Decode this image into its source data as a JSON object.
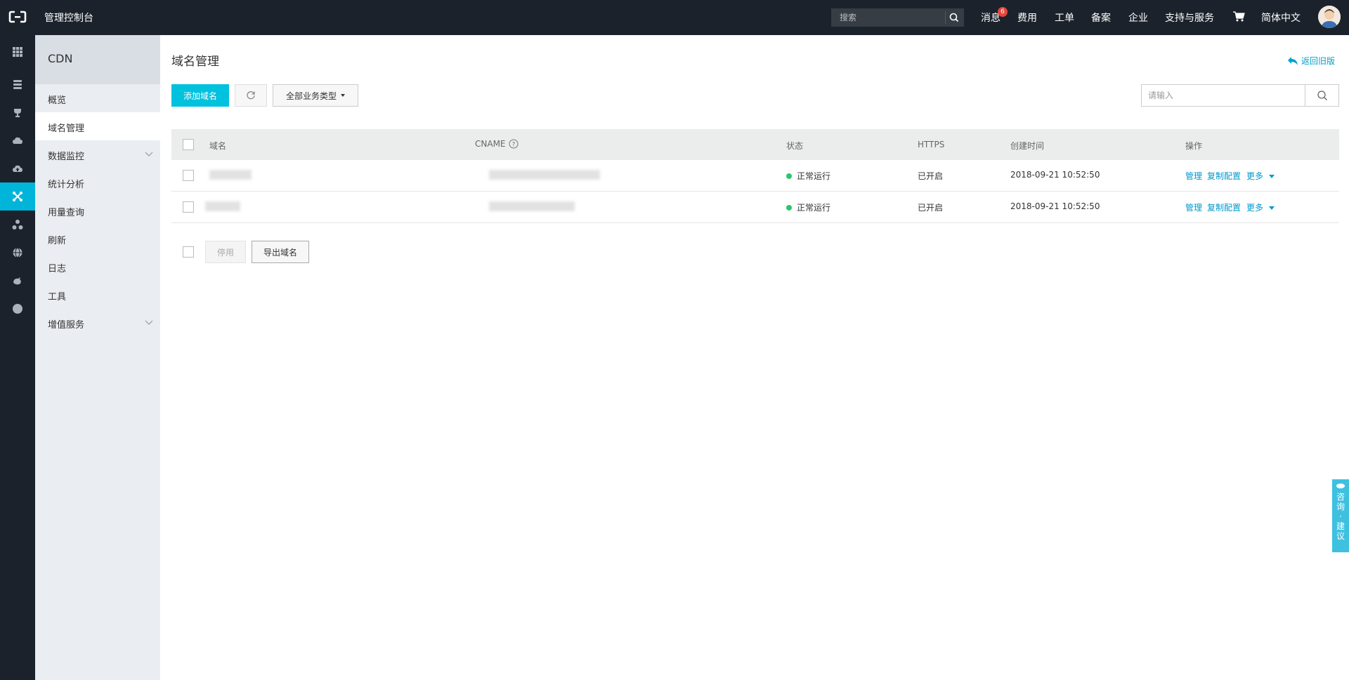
{
  "header": {
    "console_title": "管理控制台",
    "search_placeholder": "搜索",
    "nav": [
      "消息",
      "费用",
      "工单",
      "备案",
      "企业",
      "支持与服务",
      "简体中文"
    ],
    "message_badge": "6"
  },
  "rail": [
    "apps-icon",
    "database-icon",
    "trophy-icon",
    "cloud-icon",
    "cloud-upload-icon",
    "cdn-icon",
    "network-icon",
    "globe-icon",
    "bird-icon",
    "circle-icon"
  ],
  "sidebar": {
    "title": "CDN",
    "items": [
      "概览",
      "域名管理",
      "数据监控",
      "统计分析",
      "用量查询",
      "刷新",
      "日志",
      "工具",
      "增值服务"
    ]
  },
  "main": {
    "title": "域名管理",
    "back_link": "返回旧版",
    "add_domain": "添加域名",
    "business_type": "全部业务类型",
    "search_placeholder": "请输入",
    "columns": [
      "域名",
      "CNAME",
      "状态",
      "HTTPS",
      "创建时间",
      "操作"
    ],
    "rows": [
      {
        "status": "正常运行",
        "https": "已开启",
        "created": "2018-09-21 10:52:50"
      },
      {
        "status": "正常运行",
        "https": "已开启",
        "created": "2018-09-21 10:52:50"
      }
    ],
    "actions": {
      "manage": "管理",
      "copy": "复制配置",
      "more": "更多"
    },
    "disable": "停用",
    "export": "导出域名"
  },
  "feedback": [
    "咨",
    "询",
    "·",
    "建",
    "议"
  ],
  "colors": {
    "accent": "#00c1de",
    "topbar": "#1b222b",
    "link": "#0099cc",
    "status_ok": "#2ac76a"
  }
}
